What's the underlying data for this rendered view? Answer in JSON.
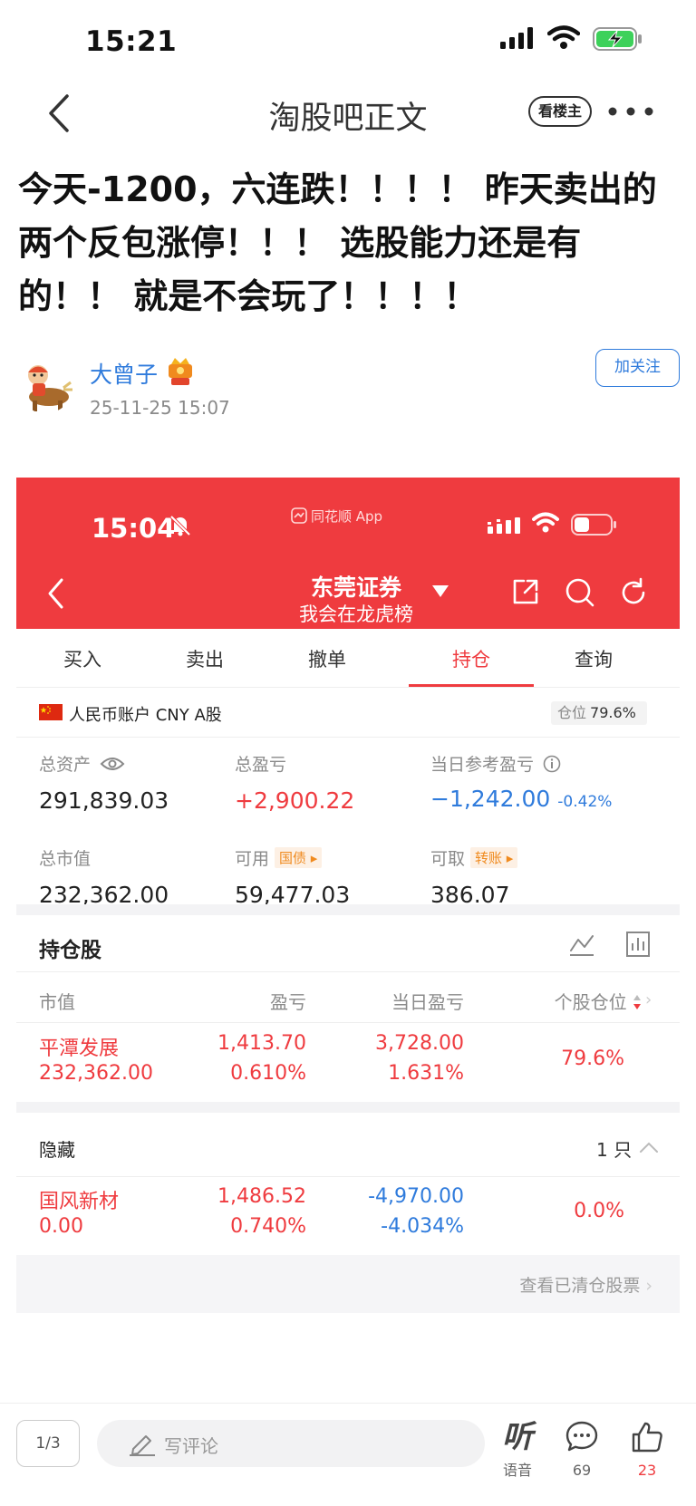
{
  "status_bar": {
    "time": "15:21"
  },
  "nav": {
    "title": "淘股吧正文",
    "louzhu_label": "看楼主"
  },
  "post": {
    "title": "今天-1200，六连跌！！！！ 昨天卖出的两个反包涨停！！！ 选股能力还是有的！！ 就是不会玩了！！！！",
    "author": "大曾子",
    "time": "25-11-25 15:07",
    "follow_label": "加关注"
  },
  "screenshot": {
    "status_time": "15:04",
    "app_name": "同花顺 App",
    "broker": "东莞证券",
    "broker_sub": "我会在龙虎榜",
    "tabs": [
      "买入",
      "卖出",
      "撤单",
      "持仓",
      "查询"
    ],
    "active_tab": "持仓",
    "account_label": "人民币账户 CNY A股",
    "position_ratio_label": "仓位",
    "position_ratio": "79.6%",
    "metrics": {
      "total_assets_label": "总资产",
      "total_assets": "291,839.03",
      "total_pl_label": "总盈亏",
      "total_pl": "+2,900.22",
      "day_pl_label": "当日参考盈亏",
      "day_pl": "−1,242.00",
      "day_pl_pct": "-0.42%",
      "market_value_label": "总市值",
      "market_value": "232,362.00",
      "available_label": "可用",
      "available_chip": "国债",
      "available": "59,477.03",
      "withdrawable_label": "可取",
      "withdrawable_chip": "转账",
      "withdrawable": "386.07"
    },
    "holdings_title": "持仓股",
    "columns": [
      "市值",
      "盈亏",
      "当日盈亏",
      "个股仓位"
    ],
    "holdings": [
      {
        "name": "平潭发展",
        "market_value": "232,362.00",
        "pl": "1,413.70",
        "pl_pct": "0.610%",
        "day_pl": "3,728.00",
        "day_pl_pct": "1.631%",
        "weight": "79.6%"
      }
    ],
    "hidden_label": "隐藏",
    "hidden_count": "1 只",
    "hidden": [
      {
        "name": "国风新材",
        "market_value": "0.00",
        "pl": "1,486.52",
        "pl_pct": "0.740%",
        "day_pl": "-4,970.00",
        "day_pl_pct": "-4.034%",
        "weight": "0.0%"
      }
    ],
    "cleared_link": "查看已清仓股票"
  },
  "bottom": {
    "page_indicator": "1/3",
    "comment_placeholder": "写评论",
    "listen_glyph": "听",
    "listen_label": "语音",
    "comment_count": "69",
    "like_count": "23"
  },
  "colors": {
    "accent_red": "#ef3b3f",
    "link_blue": "#2f7bdc"
  }
}
